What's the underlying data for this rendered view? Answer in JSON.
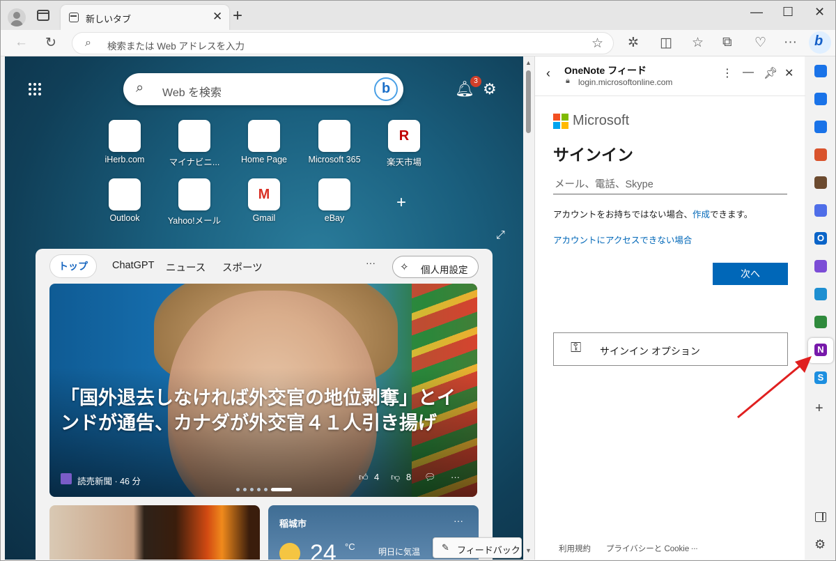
{
  "browser": {
    "tab_title": "新しいタブ",
    "tab_close": "✕",
    "new_tab": "+",
    "window_controls": [
      "—",
      "☐",
      "✕"
    ],
    "address_placeholder": "検索または Web アドレスを入力",
    "favorite_star": "☆"
  },
  "ntp": {
    "search_placeholder": "Web を検索",
    "notification_count": "3",
    "quick_links": [
      {
        "label": "iHerb.com",
        "glyph": "",
        "color": "#6aa84f"
      },
      {
        "label": "マイナビニ...",
        "glyph": "",
        "color": "#444444"
      },
      {
        "label": "Home Page",
        "glyph": "",
        "color": "#3a77b5"
      },
      {
        "label": "Microsoft 365",
        "glyph": "",
        "color": "#7b4fd8"
      },
      {
        "label": "楽天市場",
        "glyph": "R",
        "color": "#bf0000"
      },
      {
        "label": "Outlook",
        "glyph": "",
        "color": "#0a64c8"
      },
      {
        "label": "Yahoo!メール",
        "glyph": "",
        "color": "#888888"
      },
      {
        "label": "Gmail",
        "glyph": "M",
        "color": "#d93025"
      },
      {
        "label": "eBay",
        "glyph": "",
        "color": "#222222"
      }
    ]
  },
  "news": {
    "tabs": [
      "トップ",
      "ChatGPT",
      "ニュース",
      "スポーツ"
    ],
    "more": "···",
    "personalize": "個人用設定",
    "headline": "「国外退去しなければ外交官の地位剥奪」とインドが通告、カナダが外交官４１人引き揚げ",
    "source": "読売新聞 · 46 分",
    "likes": "4",
    "dislikes": "8",
    "weather_city": "稲城市",
    "weather_temp": "24",
    "weather_unit": "°C",
    "weather_tomorrow": "明日に気温",
    "feedback": "フィードバック"
  },
  "panel": {
    "title": "OneNote フィード",
    "url": "login.microsoftonline.com",
    "brand": "Microsoft",
    "heading": "サインイン",
    "email_placeholder": "メール、電話、Skype",
    "no_account_prefix": "アカウントをお持ちではない場合、",
    "no_account_link": "作成",
    "no_account_suffix": "できます。",
    "cant_access": "アカウントにアクセスできない場合",
    "next": "次へ",
    "signin_options": "サインイン オプション",
    "footer": [
      "利用規約",
      "プライバシーと Cookie",
      "..."
    ]
  },
  "rail": {
    "icons": [
      {
        "name": "bell-icon",
        "color": "#1a73e8",
        "glyph": ""
      },
      {
        "name": "search-icon",
        "color": "#1a73e8",
        "glyph": ""
      },
      {
        "name": "tag-icon",
        "color": "#1a73e8",
        "glyph": ""
      },
      {
        "name": "toolbox-icon",
        "color": "#d9532c",
        "glyph": ""
      },
      {
        "name": "chess-icon",
        "color": "#6b4a2f",
        "glyph": ""
      },
      {
        "name": "copilot-icon",
        "color": "#4f6ee8",
        "glyph": ""
      },
      {
        "name": "outlook-icon",
        "color": "#0a64c8",
        "glyph": "O"
      },
      {
        "name": "designer-icon",
        "color": "#7c4dd6",
        "glyph": ""
      },
      {
        "name": "send-icon",
        "color": "#1e8fd1",
        "glyph": ""
      },
      {
        "name": "tree-icon",
        "color": "#2f8a3c",
        "glyph": ""
      },
      {
        "name": "onenote-icon",
        "color": "#7719aa",
        "glyph": "N"
      },
      {
        "name": "skype-icon",
        "color": "#1d8fe0",
        "glyph": "S"
      }
    ],
    "add": "+"
  }
}
